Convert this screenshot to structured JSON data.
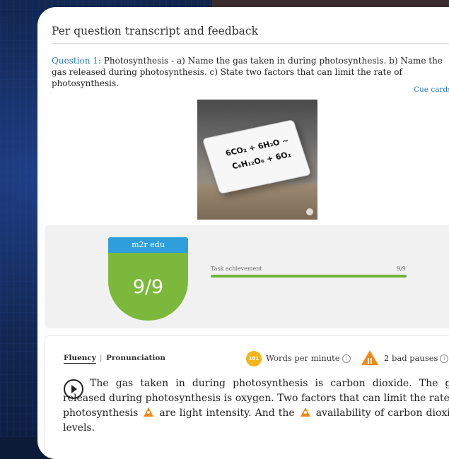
{
  "card": {
    "title": "Per question transcript and feedback"
  },
  "question": {
    "label": "Question 1:",
    "text": "Photosynthesis - a) Name the gas taken in during photosynthesis. b) Name the gas released during photosynthesis. c) State two factors that can limit the rate of photosynthesis."
  },
  "cue_cards": {
    "link_label": "Cue cards",
    "equation_line1": "6CO₂ + 6H₂O ~",
    "equation_line2": "C₆H₁₂O₆ + 6O₂"
  },
  "score": {
    "brand": "m2r edu",
    "overall": "9/9",
    "task_label": "Task achievement",
    "task_score": "9/9",
    "task_progress": 1.0,
    "colors": {
      "brand_blue": "#2e9fdb",
      "score_green": "#7cb83c",
      "bar_green": "#6fb33a"
    }
  },
  "feedback": {
    "tabs": [
      {
        "label": "Fluency",
        "active": true
      },
      {
        "label": "Pronunciation",
        "active": false
      }
    ],
    "tab_separator": "|",
    "wpm_value": "101",
    "wpm_label": "Words per minute",
    "pauses_label": "2 bad pauses",
    "info_glyph": "i",
    "icons": {
      "wpm": "speed-badge-icon",
      "pauses": "warning-pause-icon",
      "play": "play-icon"
    },
    "transcript": {
      "part1": "The gas taken in during photosynthesis is carbon dioxide. The gas released during photosynthesis is oxygen. Two factors that can limit the rate of photosynthesis",
      "part2": "are light intensity. And the",
      "part3": "availability of carbon dioxide levels."
    }
  }
}
